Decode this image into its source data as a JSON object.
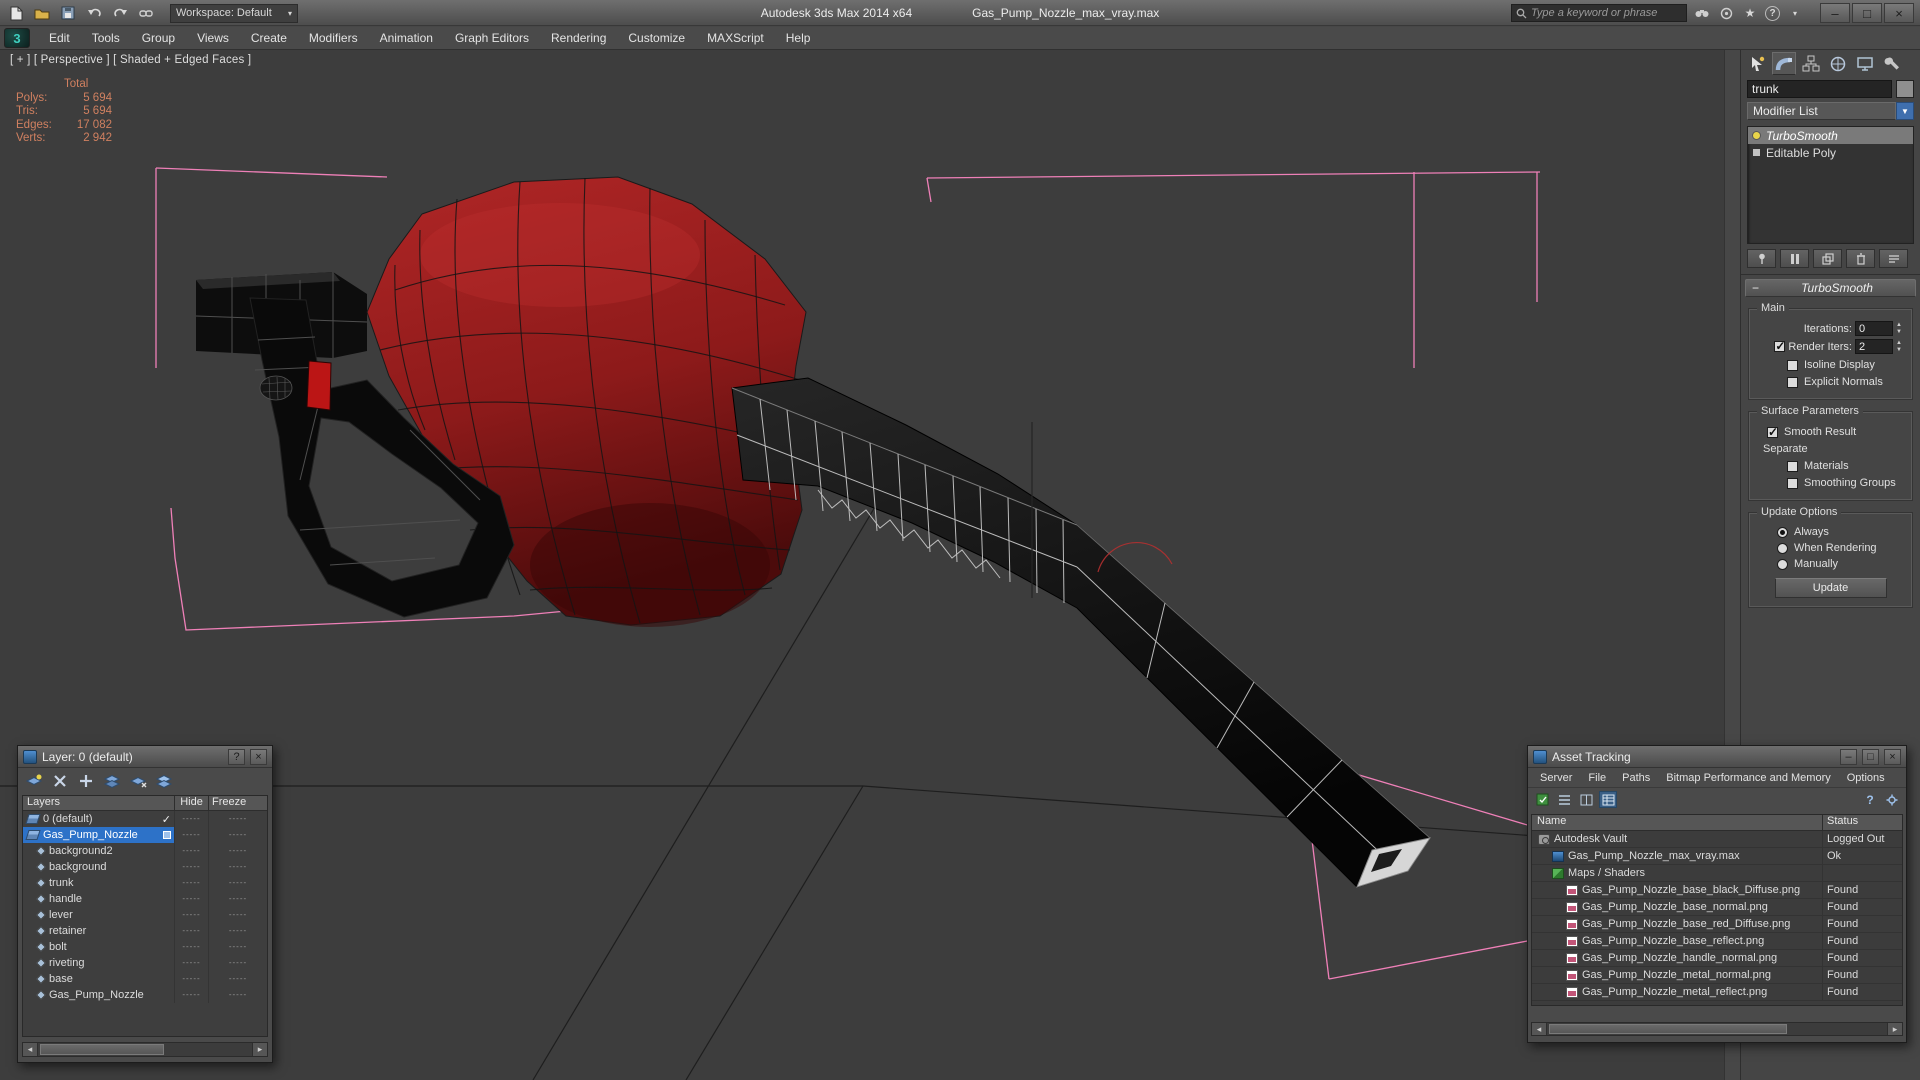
{
  "colors": {
    "selection_blue": "#2d72c8",
    "stats_text": "#d08060",
    "pink_outline": "#ef80b8",
    "body_red": "#a82020",
    "viewport_bg": "#3d3d3d",
    "panel_bg": "#454545"
  },
  "title_bar": {
    "app_title": "Autodesk 3ds Max 2014 x64",
    "document_title": "Gas_Pump_Nozzle_max_vray.max",
    "workspace_label": "Workspace: Default",
    "search_placeholder": "Type a keyword or phrase",
    "minimize": "–",
    "maximize": "□",
    "close": "×"
  },
  "menu_bar": {
    "items": [
      "Edit",
      "Tools",
      "Group",
      "Views",
      "Create",
      "Modifiers",
      "Animation",
      "Graph Editors",
      "Rendering",
      "Customize",
      "MAXScript",
      "Help"
    ]
  },
  "viewport": {
    "label": "[ + ] [ Perspective ] [ Shaded + Edged Faces ]",
    "stats": {
      "header": "Total",
      "rows": [
        {
          "label": "Polys:",
          "value": "5 694"
        },
        {
          "label": "Tris:",
          "value": "5 694"
        },
        {
          "label": "Edges:",
          "value": "17 082"
        },
        {
          "label": "Verts:",
          "value": "2 942"
        }
      ]
    }
  },
  "command_panel": {
    "object_name": "trunk",
    "modifier_list_label": "Modifier List",
    "stack": [
      {
        "label": "TurboSmooth",
        "icon": "lightbulb-icon",
        "selected": true,
        "italic": true
      },
      {
        "label": "Editable Poly",
        "icon": "editable-poly-icon",
        "selected": false,
        "italic": false
      }
    ],
    "rollout": {
      "title": "TurboSmooth",
      "main_group": "Main",
      "iterations_label": "Iterations:",
      "iterations_value": "0",
      "render_iters_label": "Render Iters:",
      "render_iters_value": "2",
      "render_iters_checked": true,
      "isoline_label": "Isoline Display",
      "isoline_checked": false,
      "explicit_label": "Explicit Normals",
      "explicit_checked": false,
      "surface_group": "Surface Parameters",
      "smooth_result_label": "Smooth Result",
      "smooth_result_checked": true,
      "separate_label": "Separate",
      "materials_label": "Materials",
      "materials_checked": false,
      "smoothing_label": "Smoothing Groups",
      "smoothing_checked": false,
      "update_group": "Update Options",
      "options": [
        "Always",
        "When Rendering",
        "Manually"
      ],
      "selected_option": "Always",
      "update_button": "Update"
    }
  },
  "layer_dialog": {
    "title": "Layer: 0 (default)",
    "help_button": "?",
    "close_button": "×",
    "columns": [
      "Layers",
      "Hide",
      "Freeze"
    ],
    "rows": [
      {
        "name": "0 (default)",
        "indent": 0,
        "current": true
      },
      {
        "name": "Gas_Pump_Nozzle",
        "indent": 0,
        "selected": true
      },
      {
        "name": "background2",
        "indent": 1
      },
      {
        "name": "background",
        "indent": 1
      },
      {
        "name": "trunk",
        "indent": 1
      },
      {
        "name": "handle",
        "indent": 1
      },
      {
        "name": "lever",
        "indent": 1
      },
      {
        "name": "retainer",
        "indent": 1
      },
      {
        "name": "bolt",
        "indent": 1
      },
      {
        "name": "riveting",
        "indent": 1
      },
      {
        "name": "base",
        "indent": 1
      },
      {
        "name": "Gas_Pump_Nozzle",
        "indent": 1
      }
    ]
  },
  "asset_tracking": {
    "title": "Asset Tracking",
    "menu": [
      "Server",
      "File",
      "Paths",
      "Bitmap Performance and Memory",
      "Options"
    ],
    "columns": [
      "Name",
      "Status"
    ],
    "rows": [
      {
        "name": "Autodesk Vault",
        "status": "Logged Out",
        "icon": "vault",
        "indent": 0
      },
      {
        "name": "Gas_Pump_Nozzle_max_vray.max",
        "status": "Ok",
        "icon": "max",
        "indent": 1
      },
      {
        "name": "Maps / Shaders",
        "status": "",
        "icon": "maps",
        "indent": 1
      },
      {
        "name": "Gas_Pump_Nozzle_base_black_Diffuse.png",
        "status": "Found",
        "icon": "png",
        "indent": 2
      },
      {
        "name": "Gas_Pump_Nozzle_base_normal.png",
        "status": "Found",
        "icon": "png",
        "indent": 2
      },
      {
        "name": "Gas_Pump_Nozzle_base_red_Diffuse.png",
        "status": "Found",
        "icon": "png",
        "indent": 2
      },
      {
        "name": "Gas_Pump_Nozzle_base_reflect.png",
        "status": "Found",
        "icon": "png",
        "indent": 2
      },
      {
        "name": "Gas_Pump_Nozzle_handle_normal.png",
        "status": "Found",
        "icon": "png",
        "indent": 2
      },
      {
        "name": "Gas_Pump_Nozzle_metal_normal.png",
        "status": "Found",
        "icon": "png",
        "indent": 2
      },
      {
        "name": "Gas_Pump_Nozzle_metal_reflect.png",
        "status": "Found",
        "icon": "png",
        "indent": 2
      }
    ]
  }
}
